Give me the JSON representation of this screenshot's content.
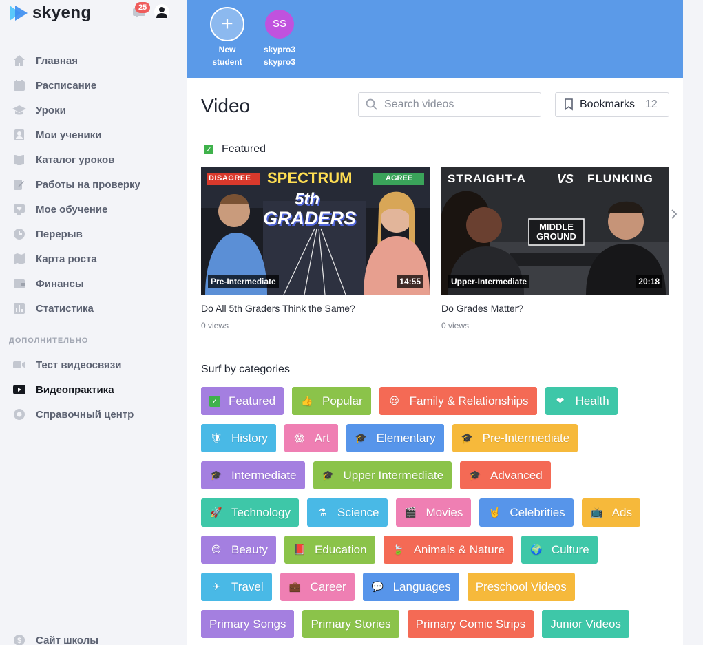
{
  "brand": {
    "name": "skyeng"
  },
  "header": {
    "notifications_count": "25"
  },
  "nav": {
    "items": [
      {
        "label": "Главная",
        "icon": "home-icon"
      },
      {
        "label": "Расписание",
        "icon": "calendar-icon"
      },
      {
        "label": "Уроки",
        "icon": "graduation-cap-icon"
      },
      {
        "label": "Мои ученики",
        "icon": "students-icon"
      },
      {
        "label": "Каталог уроков",
        "icon": "book-icon"
      },
      {
        "label": "Работы на проверку",
        "icon": "edit-icon"
      },
      {
        "label": "Мое обучение",
        "icon": "heart-tv-icon"
      },
      {
        "label": "Перерыв",
        "icon": "clock-icon"
      },
      {
        "label": "Карта роста",
        "icon": "map-icon"
      },
      {
        "label": "Финансы",
        "icon": "wallet-icon"
      },
      {
        "label": "Статистика",
        "icon": "bar-chart-icon"
      }
    ],
    "extra_label": "ДОПОЛНИТЕЛЬНО",
    "extra_items": [
      {
        "label": "Тест видеосвязи",
        "icon": "video-camera-icon"
      },
      {
        "label": "Видеопрактика",
        "icon": "play-icon"
      },
      {
        "label": "Справочный центр",
        "icon": "lifebuoy-icon"
      }
    ],
    "footer_item": {
      "label": "Сайт школы",
      "icon": "dollar-icon"
    }
  },
  "students": {
    "new": {
      "line1": "New",
      "line2": "student"
    },
    "existing": {
      "initials": "SS",
      "line1": "skypro3",
      "line2": "skypro3"
    }
  },
  "main": {
    "title": "Video",
    "search_placeholder": "Search videos",
    "bookmarks_label": "Bookmarks",
    "bookmarks_count": "12",
    "featured_label": "Featured",
    "surf_label": "Surf by categories"
  },
  "videos": [
    {
      "level": "Pre-Intermediate",
      "duration": "14:55",
      "title": "Do All 5th Graders Think the Same?",
      "views": "0 views",
      "thumb": {
        "tag_left": "DISAGREE",
        "headline": "SPECTRUM",
        "tag_right": "AGREE",
        "big1": "5th",
        "big2": "GRADERS"
      }
    },
    {
      "level": "Upper-Intermediate",
      "duration": "20:18",
      "title": "Do Grades Matter?",
      "views": "0 views",
      "thumb": {
        "headline_a": "STRAIGHT-A",
        "vs": "VS",
        "headline_b": "FLUNKING",
        "box1": "MIDDLE",
        "box2": "GROUND"
      }
    }
  ],
  "categories": [
    [
      {
        "label": "Featured",
        "color": "#a47fe0",
        "icon": "check-icon"
      },
      {
        "label": "Popular",
        "color": "#8bc34a",
        "icon": "thumbs-up-icon"
      },
      {
        "label": "Family & Relationships",
        "color": "#f46a55",
        "icon": "heart-eyes-icon"
      },
      {
        "label": "Health",
        "color": "#3ec7a8",
        "icon": "heart-icon"
      }
    ],
    [
      {
        "label": "History",
        "color": "#49b9e6",
        "icon": "shield-icon"
      },
      {
        "label": "Art",
        "color": "#ef7fb3",
        "icon": "scream-face-icon"
      },
      {
        "label": "Elementary",
        "color": "#5795ea",
        "icon": "grad-cap-icon"
      },
      {
        "label": "Pre-Intermediate",
        "color": "#f6b93b",
        "icon": "grad-cap-icon"
      }
    ],
    [
      {
        "label": "Intermediate",
        "color": "#a47fe0",
        "icon": "grad-cap-icon"
      },
      {
        "label": "Upper Intermediate",
        "color": "#8bc34a",
        "icon": "grad-cap-icon"
      },
      {
        "label": "Advanced",
        "color": "#f46a55",
        "icon": "grad-cap-icon"
      }
    ],
    [
      {
        "label": "Technology",
        "color": "#3ec7a8",
        "icon": "rocket-icon"
      },
      {
        "label": "Science",
        "color": "#49b9e6",
        "icon": "flask-icon"
      },
      {
        "label": "Movies",
        "color": "#ef7fb3",
        "icon": "clapper-icon"
      },
      {
        "label": "Celebrities",
        "color": "#5795ea",
        "icon": "rock-hand-icon"
      },
      {
        "label": "Ads",
        "color": "#f6b93b",
        "icon": "tv-icon"
      }
    ],
    [
      {
        "label": "Beauty",
        "color": "#a47fe0",
        "icon": "face-icon"
      },
      {
        "label": "Education",
        "color": "#8bc34a",
        "icon": "book-icon"
      },
      {
        "label": "Animals & Nature",
        "color": "#f46a55",
        "icon": "leaf-icon"
      },
      {
        "label": "Culture",
        "color": "#3ec7a8",
        "icon": "globe-icon"
      }
    ],
    [
      {
        "label": "Travel",
        "color": "#49b9e6",
        "icon": "plane-icon"
      },
      {
        "label": "Career",
        "color": "#ef7fb3",
        "icon": "briefcase-icon"
      },
      {
        "label": "Languages",
        "color": "#5795ea",
        "icon": "speech-bubble-icon"
      },
      {
        "label": "Preschool Videos",
        "color": "#f6b93b",
        "icon": ""
      }
    ],
    [
      {
        "label": "Primary Songs",
        "color": "#a47fe0",
        "icon": ""
      },
      {
        "label": "Primary Stories",
        "color": "#8bc34a",
        "icon": ""
      },
      {
        "label": "Primary Comic Strips",
        "color": "#f46a55",
        "icon": ""
      },
      {
        "label": "Junior Videos",
        "color": "#3ec7a8",
        "icon": ""
      }
    ]
  ]
}
